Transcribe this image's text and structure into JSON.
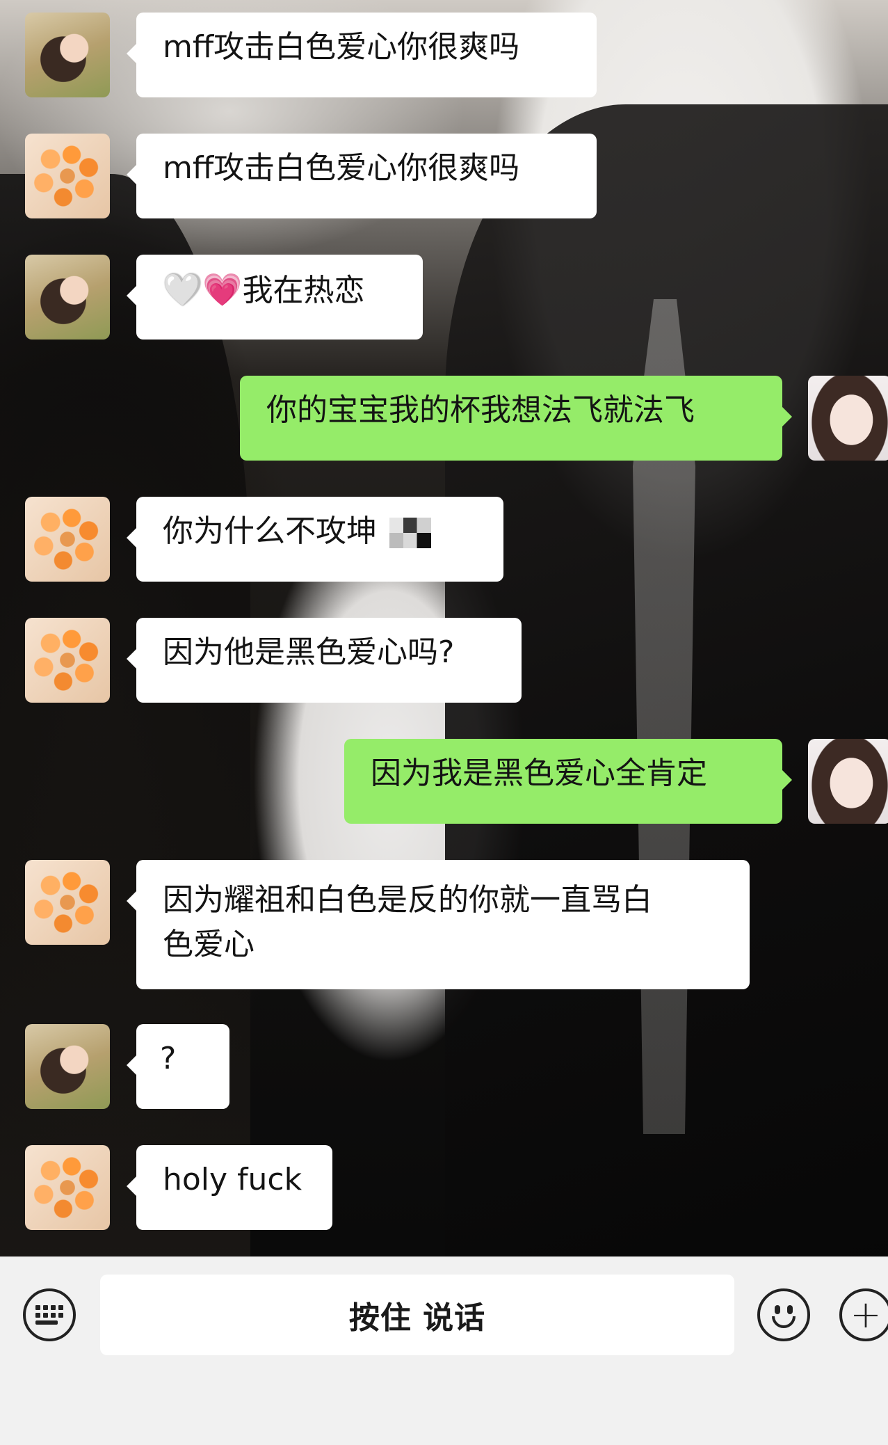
{
  "messages": [
    {
      "side": "in",
      "avatar": "girl-photo-icon",
      "text": "mff攻击白色爱心你很爽吗"
    },
    {
      "side": "in",
      "avatar": "orange-beads-icon",
      "text": "mff攻击白色爱心你很爽吗"
    },
    {
      "side": "in",
      "avatar": "girl-photo-icon",
      "heart1": "🤍",
      "heart2": "💗",
      "text": "我在热恋"
    },
    {
      "side": "out",
      "avatar": "my-avatar-icon",
      "text": "你的宝宝我的杯我想法飞就法飞"
    },
    {
      "side": "in",
      "avatar": "orange-beads-icon",
      "text": "你为什么不攻坤"
    },
    {
      "side": "in",
      "avatar": "orange-beads-icon",
      "text": "因为他是黑色爱心吗?"
    },
    {
      "side": "out",
      "avatar": "my-avatar-icon",
      "text": "因为我是黑色爱心全肯定"
    },
    {
      "side": "in",
      "avatar": "orange-beads-icon",
      "line1": "因为耀祖和白色是反的你就一直骂白",
      "line2": "色爱心"
    },
    {
      "side": "in",
      "avatar": "girl-photo-icon",
      "text": "?"
    },
    {
      "side": "in",
      "avatar": "orange-beads-icon",
      "text": "holy fuck"
    }
  ],
  "input_bar": {
    "hold_to_talk_label": "按住 说话",
    "left_icon": "keyboard-icon",
    "emoji_icon": "emoji-icon",
    "plus_icon": "plus-icon",
    "plus_glyph": "+"
  },
  "colors": {
    "incoming_bubble": "#ffffff",
    "outgoing_bubble": "#95ec69",
    "input_bar_bg": "#f1f1f1"
  }
}
